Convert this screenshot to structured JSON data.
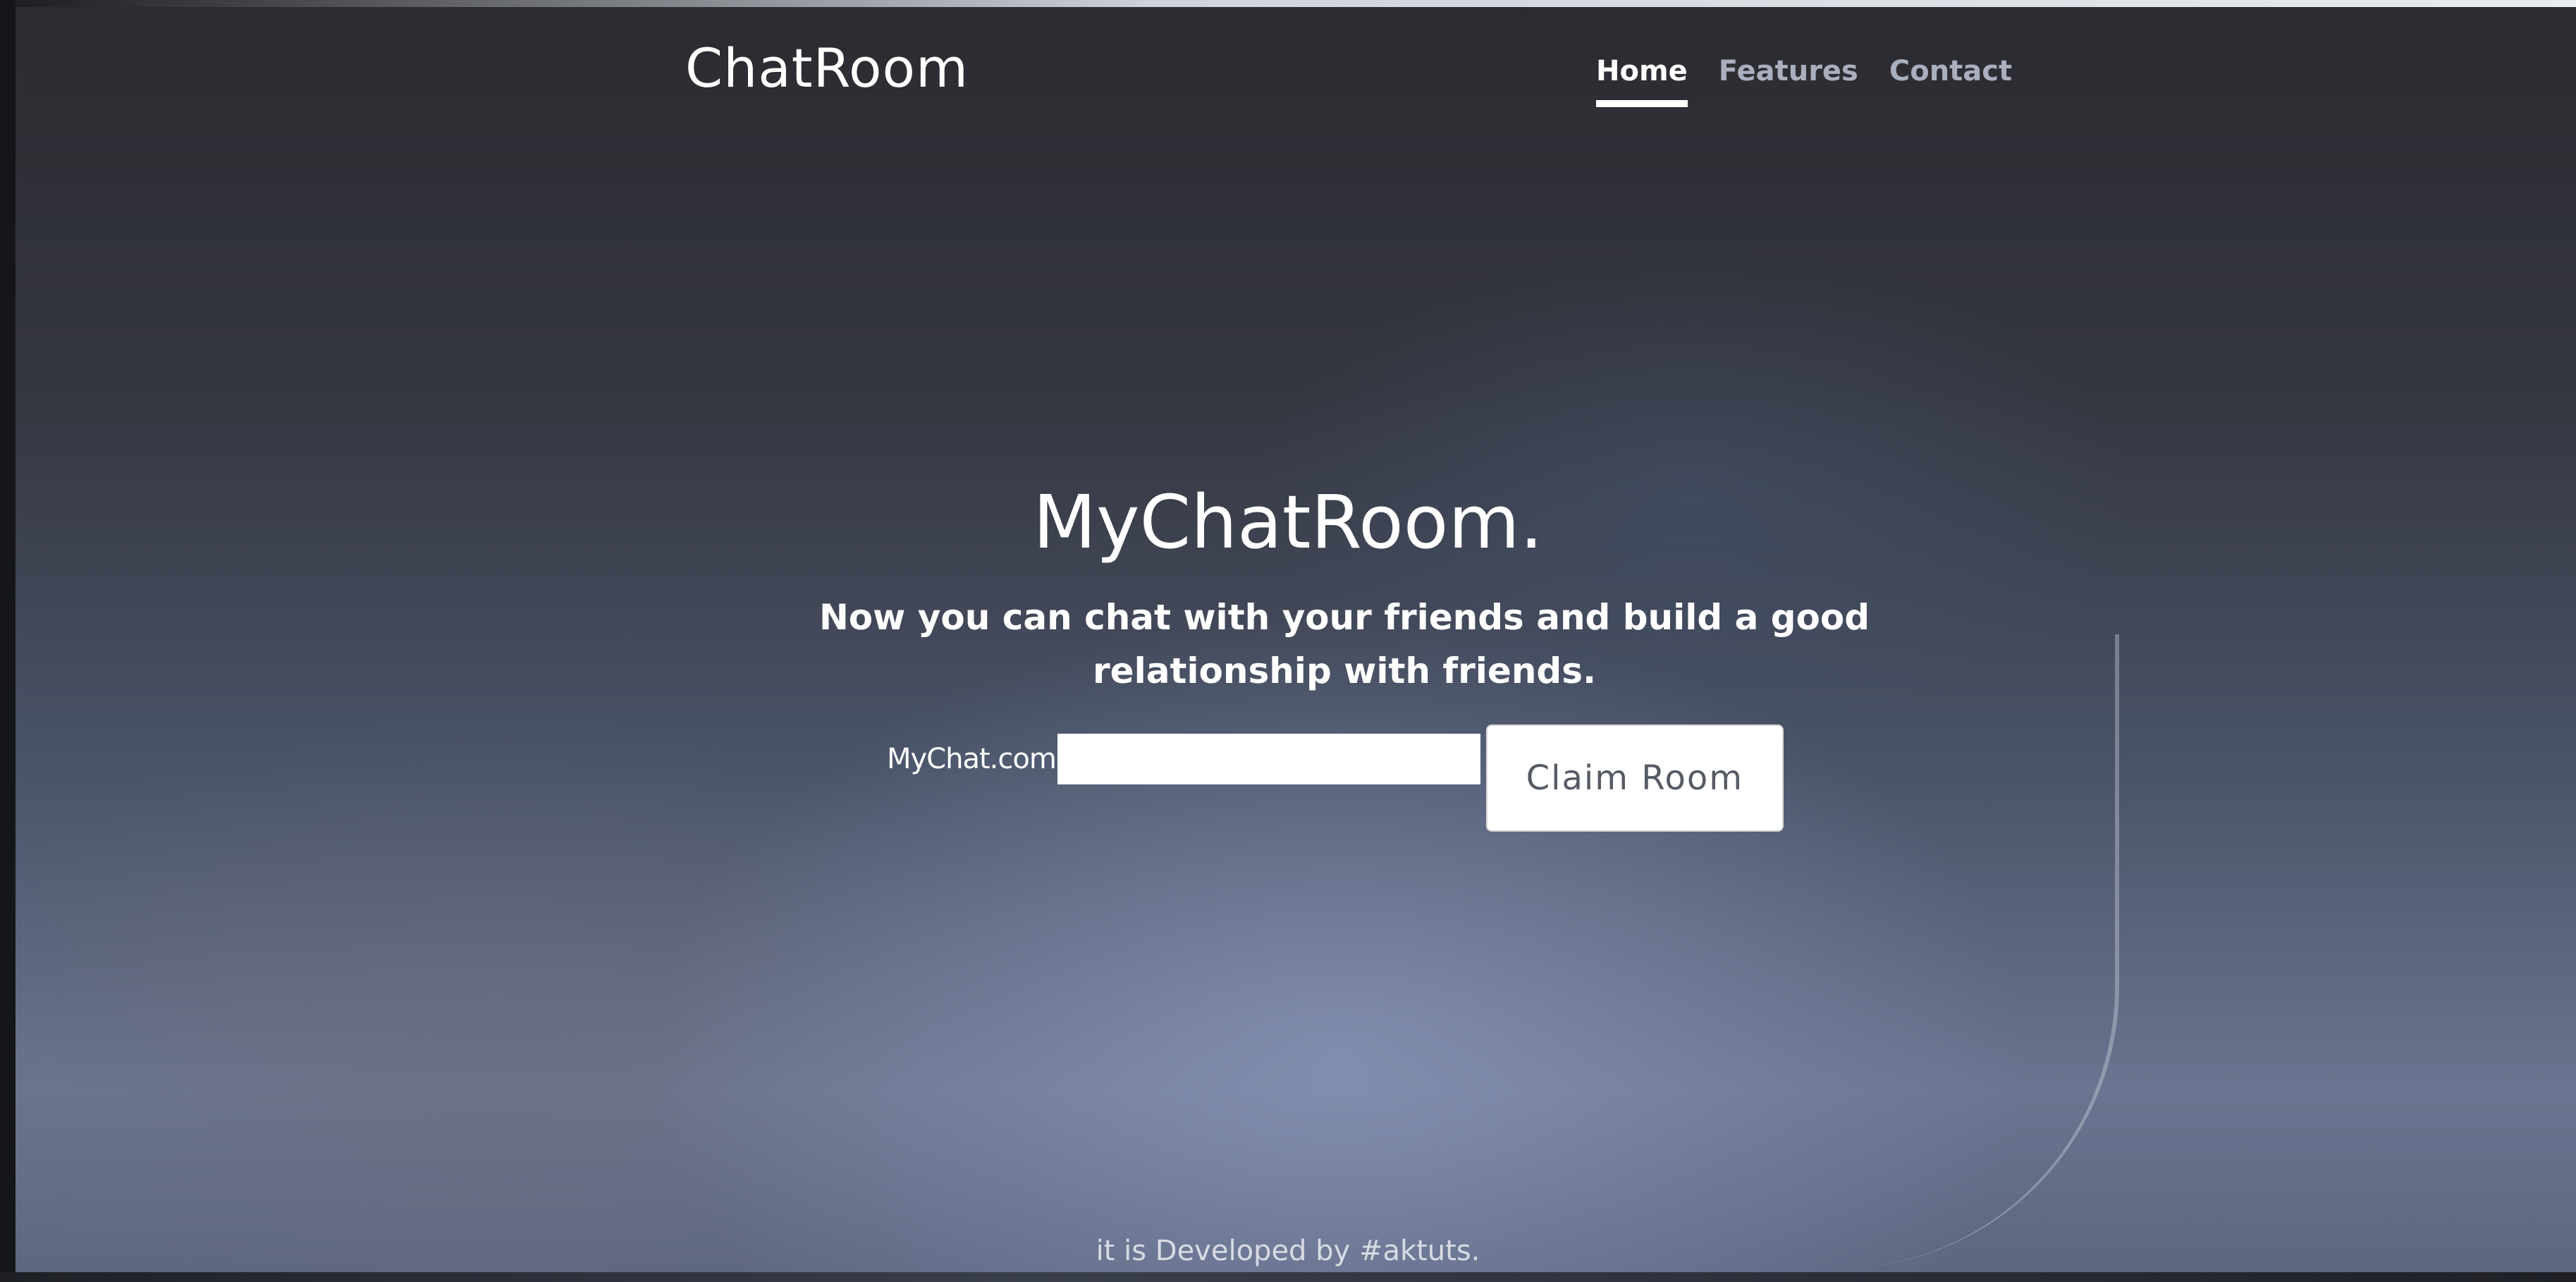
{
  "navbar": {
    "brand": "ChatRoom",
    "links": [
      {
        "label": "Home",
        "active": true
      },
      {
        "label": "Features",
        "active": false
      },
      {
        "label": "Contact",
        "active": false
      }
    ]
  },
  "hero": {
    "title": "MyChatRoom.",
    "subtitle": "Now you can chat with your friends and build a good relationship with friends.",
    "domain_prefix": "MyChat.com",
    "input_value": "",
    "button_label": "Claim Room"
  },
  "footer": {
    "text": "it is Developed by #aktuts."
  },
  "colors": {
    "nav_active": "#ffffff",
    "nav_inactive": "#a9afbd",
    "button_text": "#555a63"
  }
}
